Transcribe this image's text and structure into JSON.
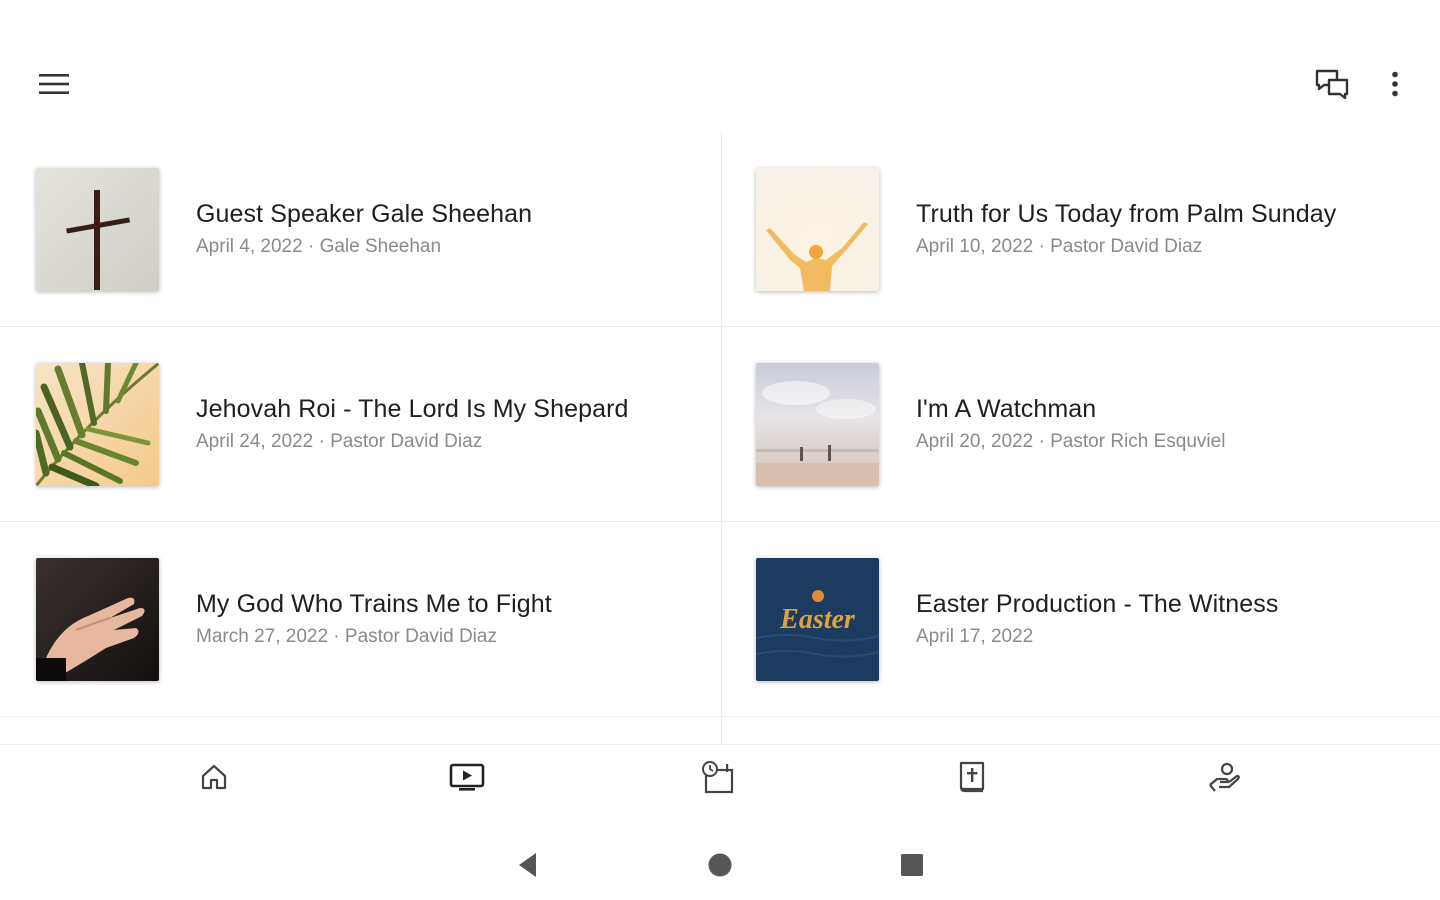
{
  "appbar": {
    "menu_icon": "hamburger-menu-icon",
    "chat_icon": "chat-bubbles-icon",
    "more_icon": "more-vert-icon"
  },
  "sermons": [
    {
      "title": "Guest Speaker Gale Sheehan",
      "meta": "April 4, 2022 · Gale Sheehan",
      "thumb": "cross"
    },
    {
      "title": "Truth for Us Today from Palm Sunday",
      "meta": "April 10, 2022 · Pastor David Diaz",
      "thumb": "raised-arms"
    },
    {
      "title": "Jehovah Roi - The Lord Is My Shepard",
      "meta": "April 24, 2022 · Pastor David Diaz",
      "thumb": "palm-leaf"
    },
    {
      "title": "I'm A Watchman",
      "meta": "April 20, 2022 · Pastor Rich Esquviel",
      "thumb": "beach-sky"
    },
    {
      "title": "My God Who Trains Me to Fight",
      "meta": "March 27, 2022 · Pastor David Diaz",
      "thumb": "open-hand"
    },
    {
      "title": "Easter Production - The Witness",
      "meta": "April 17, 2022",
      "thumb": "easter",
      "thumb_text": "Easter"
    }
  ],
  "bottom_nav": [
    {
      "icon": "home-icon",
      "active": false
    },
    {
      "icon": "tv-play-icon",
      "active": true
    },
    {
      "icon": "calendar-clock-icon",
      "active": false
    },
    {
      "icon": "bible-icon",
      "active": false
    },
    {
      "icon": "giving-hand-icon",
      "active": false
    }
  ],
  "system_nav": [
    "back-icon",
    "home-circle-icon",
    "recents-icon"
  ],
  "colors": {
    "title": "#202020",
    "meta": "#8a8a8a",
    "icon": "#333333",
    "easter_bg": "#1d3a5f",
    "easter_text": "#d9a441"
  }
}
